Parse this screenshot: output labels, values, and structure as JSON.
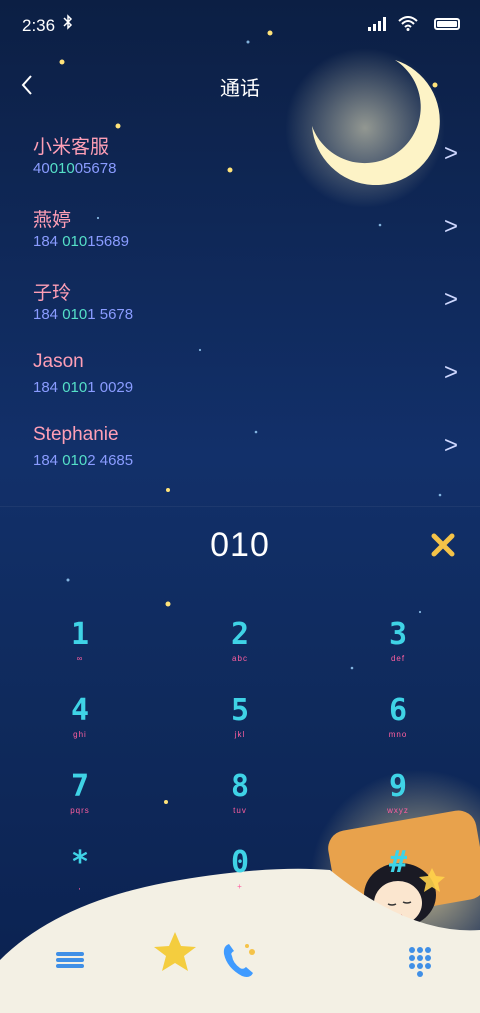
{
  "status_bar": {
    "time": "2:36"
  },
  "header": {
    "title": "通话"
  },
  "contacts": [
    {
      "name": "小米客服",
      "pre": "40",
      "match": "010",
      "post": "05678"
    },
    {
      "name": "燕婷",
      "pre": "184 ",
      "match": "010",
      "post": "15689"
    },
    {
      "name": "子玲",
      "pre": "184 ",
      "match": "010",
      "post": "1 5678"
    },
    {
      "name": "Jason",
      "pre": "184 ",
      "match": "010",
      "post": "1 0029"
    },
    {
      "name": "Stephanie",
      "pre": "184 ",
      "match": "010",
      "post": "2 4685"
    }
  ],
  "dialer": {
    "input": "010"
  },
  "keypad": [
    {
      "digit": "1",
      "letters": "∞"
    },
    {
      "digit": "2",
      "letters": "abc"
    },
    {
      "digit": "3",
      "letters": "def"
    },
    {
      "digit": "4",
      "letters": "ghi"
    },
    {
      "digit": "5",
      "letters": "jkl"
    },
    {
      "digit": "6",
      "letters": "mno"
    },
    {
      "digit": "7",
      "letters": "pqrs"
    },
    {
      "digit": "8",
      "letters": "tuv"
    },
    {
      "digit": "9",
      "letters": "wxyz"
    },
    {
      "digit": "*",
      "letters": ","
    },
    {
      "digit": "0",
      "letters": "+"
    },
    {
      "digit": "#",
      "letters": ""
    }
  ],
  "icons": {
    "back": "back-arrow-icon",
    "clear": "clear-x-icon",
    "menu": "menu-icon",
    "call": "phone-call-icon",
    "dialpad": "dialpad-icon"
  },
  "colors": {
    "name": "#ff9fb6",
    "number": "#8a9cff",
    "match": "#55e0c8",
    "key": "#3fd3e6",
    "letters": "#ff5fa0",
    "clear": "#f5c348"
  }
}
